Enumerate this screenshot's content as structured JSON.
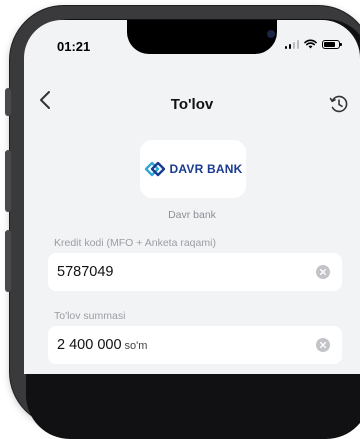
{
  "status_bar": {
    "time": "01:21"
  },
  "header": {
    "title": "To'lov"
  },
  "bank": {
    "logo_text": "DAVR BANK",
    "name": "Davr bank",
    "brand_color": "#1a3b8f",
    "accent_color": "#2fa8d8"
  },
  "form": {
    "credit_code": {
      "label": "Kredit kodi (MFO + Anketa raqami)",
      "value": "5787049"
    },
    "amount": {
      "label": "To'lov summasi",
      "value": "2 400 000",
      "unit": "so'm"
    }
  },
  "icons": [
    "back-arrow-icon",
    "history-clock-icon",
    "clear-icon",
    "signal-icon",
    "wifi-icon",
    "battery-icon"
  ]
}
